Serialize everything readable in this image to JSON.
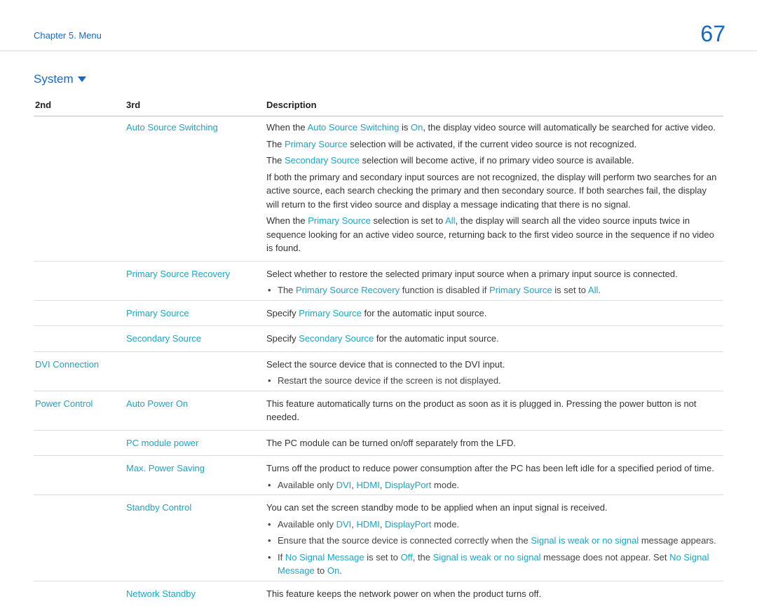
{
  "header": {
    "breadcrumb": "Chapter 5. Menu",
    "page_number": "67"
  },
  "section": {
    "title": "System"
  },
  "table": {
    "headers": {
      "c1": "2nd",
      "c2": "3rd",
      "c3": "Description"
    }
  },
  "terms": {
    "auto_source_switching": "Auto Source Switching",
    "primary_source_recovery": "Primary Source Recovery",
    "primary_source": "Primary Source",
    "secondary_source": "Secondary Source",
    "dvi_connection": "DVI Connection",
    "power_control": "Power Control",
    "auto_power_on": "Auto Power On",
    "pc_module_power": "PC module power",
    "max_power_saving": "Max. Power Saving",
    "standby_control": "Standby Control",
    "network_standby": "Network Standby",
    "on": "On",
    "off": "Off",
    "all": "All",
    "dvi": "DVI",
    "hdmi": "HDMI",
    "displayport": "DisplayPort",
    "signal_weak": "Signal is weak or no signal",
    "no_signal_message": "No Signal Message"
  },
  "text": {
    "asw_p1_a": "When the ",
    "asw_p1_b": " is ",
    "asw_p1_c": ", the display video source will automatically be searched for active video.",
    "asw_p2_a": "The ",
    "asw_p2_b": " selection will be activated, if the current video source is not recognized.",
    "asw_p3_a": "The ",
    "asw_p3_b": " selection will become active, if no primary video source is available.",
    "asw_p4": "If both the primary and secondary input sources are not recognized, the display will perform two searches for an active source, each search checking the primary and then secondary source. If both searches fail, the display will return to the first video source and display a message indicating that there is no signal.",
    "asw_p5_a": "When the ",
    "asw_p5_b": " selection is set to ",
    "asw_p5_c": ", the display will search all the video source inputs twice in sequence looking for an active video source, returning back to the first video source in the sequence if no video is found.",
    "psr_main": "Select whether to restore the selected primary input source when a primary input source is connected.",
    "psr_b_a": "The ",
    "psr_b_b": " function is disabled if ",
    "psr_b_c": " is set to ",
    "psr_b_d": ".",
    "ps_a": "Specify ",
    "ps_b": " for the automatic input source.",
    "ss_a": "Specify ",
    "ss_b": " for the automatic input source.",
    "dvi_main": "Select the source device that is connected to the DVI input.",
    "dvi_b": "Restart the source device if the screen is not displayed.",
    "apo": "This feature automatically turns on the product as soon as it is plugged in. Pressing the power button is not needed.",
    "pcm": "The PC module can be turned on/off separately from the LFD.",
    "mps": "Turns off the product to reduce power consumption after the PC has been left idle for a specified period of time.",
    "avail_a": "Available only ",
    "avail_sep": ", ",
    "avail_end": " mode.",
    "sc_main": "You can set the screen standby mode to be applied when an input signal is received.",
    "sc_b2_a": "Ensure that the source device is connected correctly when the ",
    "sc_b2_b": " message appears.",
    "sc_b3_a": "If ",
    "sc_b3_b": " is set to ",
    "sc_b3_c": ", the ",
    "sc_b3_d": " message does not appear. Set ",
    "sc_b3_e": " to ",
    "sc_b3_f": ".",
    "ns": "This feature keeps the network power on when the product turns off."
  }
}
